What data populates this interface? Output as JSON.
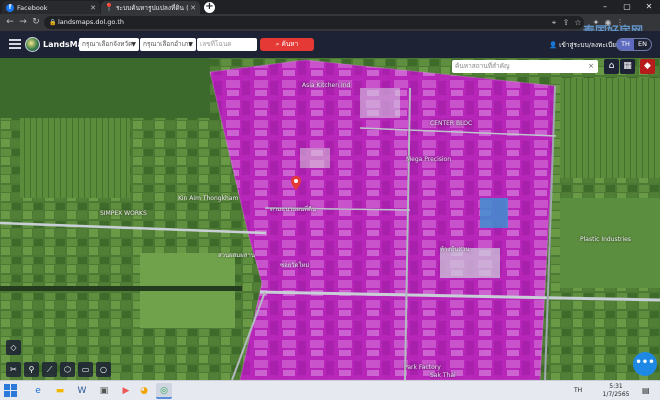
{
  "browser": {
    "tabs": [
      {
        "label": "Facebook",
        "icon": "facebook-icon"
      },
      {
        "label": "ระบบค้นหารูปแปลงที่ดิน (LandsMaps)",
        "icon": "map-pin-icon"
      }
    ],
    "new_tab": "+",
    "url": "landsmaps.dol.go.th",
    "watermark": "泰国好房网"
  },
  "header": {
    "brand": "LandsMaps",
    "province_select": "กรุณาเลือกจังหวัด",
    "district_select": "กรุณาเลือกอำเภอ",
    "parcel_placeholder": "เลขที่โฉนด",
    "search_label": "ค้นหา",
    "login_label": "เข้าสู่ระบบ/ลงทะเบียน",
    "lang_th": "TH",
    "lang_en": "EN"
  },
  "map": {
    "search_placeholder": "ค้นหาสถานที่สำคัญ",
    "search_clear": "×",
    "places": [
      {
        "label": "Asia Kitchen Ind"
      },
      {
        "label": "CENTER BLOC"
      },
      {
        "label": "Mega Precision"
      },
      {
        "label": "Kin Aim Thongkham"
      },
      {
        "label": "SIMPEX WORKS"
      },
      {
        "label": "ตามแนวแผนที่ดิน"
      },
      {
        "label": "สวนผสมผสาน"
      },
      {
        "label": "Plastic Industries"
      },
      {
        "label": "ซอยวัดใหม่"
      },
      {
        "label": "ห้างหุ้นส่วน"
      },
      {
        "label": "Park Factory"
      },
      {
        "label": "Sak Thai"
      }
    ],
    "fab_label": "•••"
  },
  "taskbar": {
    "lang": "TH",
    "time": "5:31",
    "date": "1/7/2565"
  },
  "colors": {
    "parcel_overlay": "#c81ec8",
    "header_bg": "#1d2235",
    "search_button": "#e53935",
    "fab": "#1e88e5"
  }
}
